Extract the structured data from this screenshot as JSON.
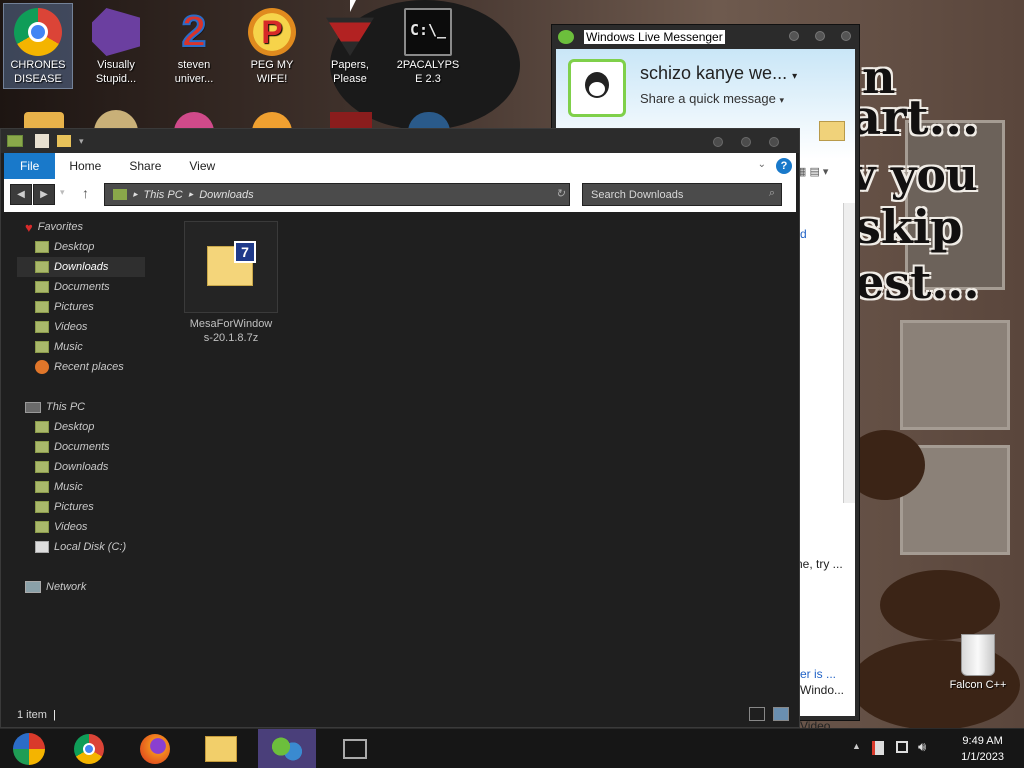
{
  "desktop": {
    "icons": [
      {
        "label": "CHRONES DISEASE",
        "icon": "chrome-icon"
      },
      {
        "label": "Visually Stupid...",
        "icon": "visual-studio-icon"
      },
      {
        "label": "steven univer...",
        "icon": "steven-universe-2-icon"
      },
      {
        "label": "PEG MY WIFE!",
        "icon": "p-logo-icon"
      },
      {
        "label": "Papers, Please",
        "icon": "papers-please-icon"
      },
      {
        "label": "2PACALYPSE 2.3",
        "icon": "terminal-icon"
      }
    ],
    "recycle_bin_label": "Falcon C++",
    "wallpaper_text": [
      "n",
      "art...",
      "v you",
      "skip",
      "est..."
    ]
  },
  "messenger": {
    "title": "Windows Live Messenger",
    "display_name": "schizo kanye we...",
    "status_prompt": "Share a quick message",
    "side_texts": [
      "d",
      "ne, try ...",
      "er is ...",
      "Windo...",
      "Video"
    ]
  },
  "explorer": {
    "ribbon_tabs": [
      "File",
      "Home",
      "Share",
      "View"
    ],
    "address": {
      "root": "This PC",
      "folder": "Downloads"
    },
    "search_placeholder": "Search Downloads",
    "favorites_label": "Favorites",
    "favorites": [
      "Desktop",
      "Downloads",
      "Documents",
      "Pictures",
      "Videos",
      "Music",
      "Recent places"
    ],
    "this_pc_label": "This PC",
    "this_pc_items": [
      "Desktop",
      "Documents",
      "Downloads",
      "Music",
      "Pictures",
      "Videos",
      "Local Disk (C:)"
    ],
    "network_label": "Network",
    "file": {
      "name": "MesaForWindows-20.1.8.7z",
      "line1": "MesaForWindow",
      "line2": "s-20.1.8.7z",
      "badge": "7"
    },
    "status": "1 item"
  },
  "taskbar": {
    "time": "9:49 AM",
    "date": "1/1/2023",
    "apps": [
      "start-orb-icon",
      "chrome-icon",
      "firefox-icon",
      "file-explorer-icon",
      "messenger-icon",
      "task-view-icon"
    ]
  },
  "colors": {
    "file_tab": "#1979ca",
    "selection": "#2f2f2f",
    "messenger_bg": "#c9e6f7"
  }
}
